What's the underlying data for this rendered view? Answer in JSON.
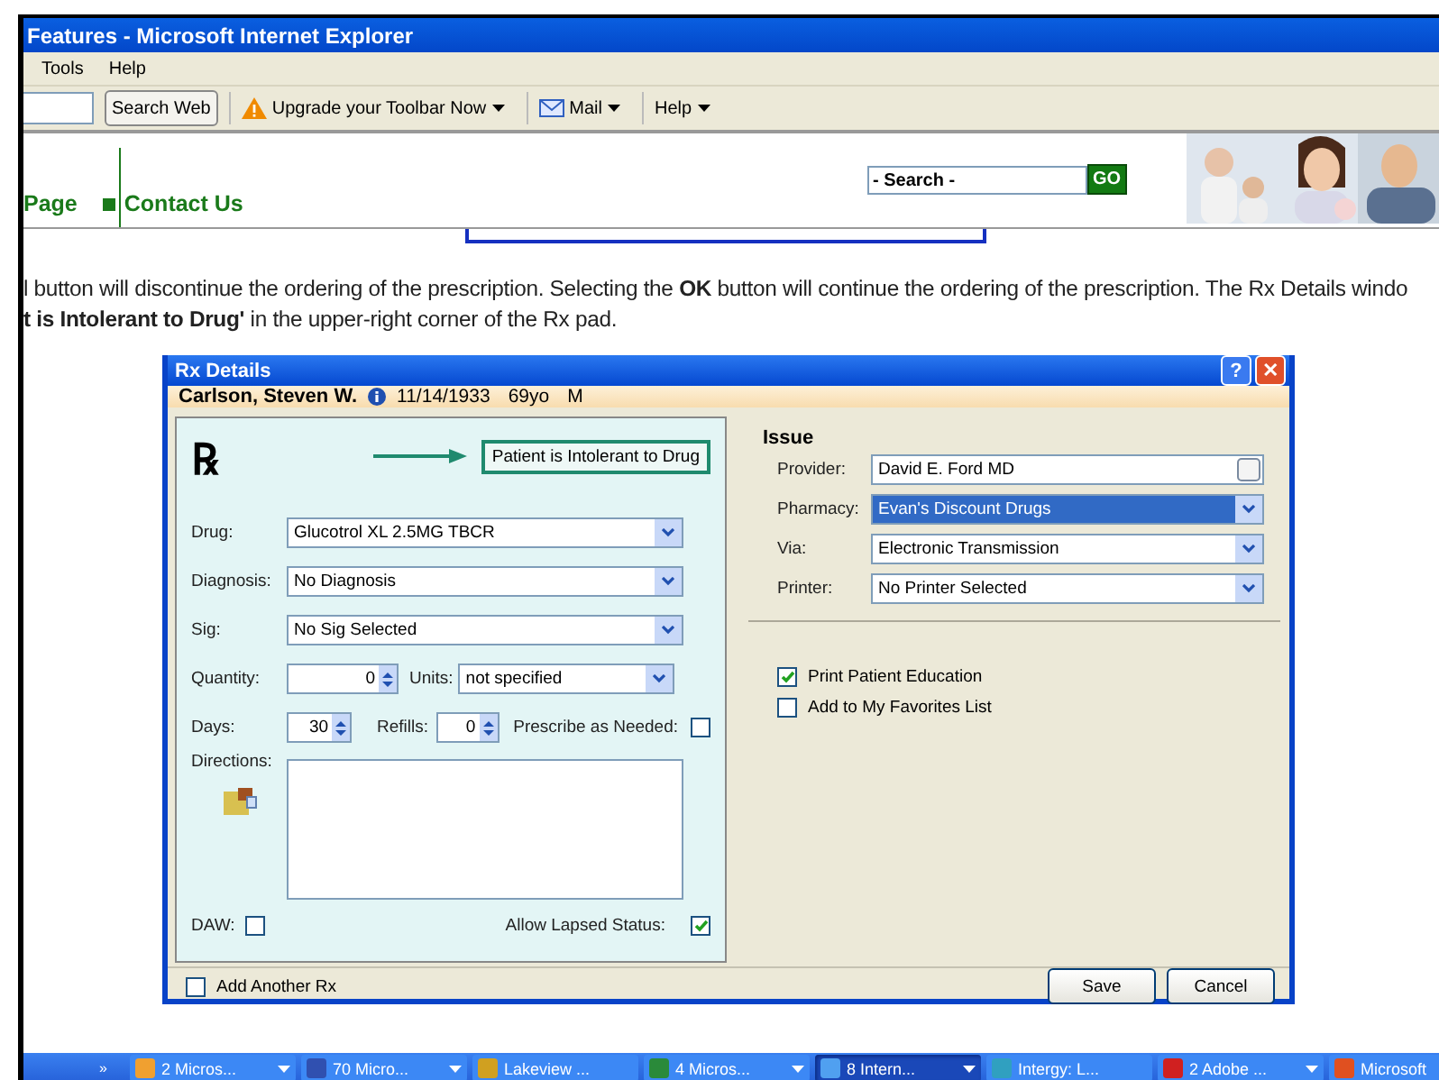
{
  "browser": {
    "title": "Features - Microsoft Internet Explorer",
    "menu": [
      "Tools",
      "Help"
    ],
    "search_button": "Search Web",
    "toolbar": [
      {
        "label": "Upgrade your Toolbar Now",
        "kind": "warning"
      },
      {
        "label": "Mail",
        "kind": "mail"
      },
      {
        "label": "Help",
        "kind": "plain"
      }
    ]
  },
  "site": {
    "nav": [
      "Page",
      "Contact Us"
    ],
    "search": {
      "placeholder": "- Search -"
    },
    "go": "GO"
  },
  "body_text": [
    "l button will discontinue the ordering of the prescription. Selecting the **OK** button will continue the ordering of the prescription. The Rx Details windo",
    "**t is Intolerant to Drug'** in the upper-right corner of the Rx pad."
  ],
  "dialog": {
    "title": "Rx Details",
    "help_button": "?",
    "close_button": "✕",
    "patient": {
      "name": "Carlson, Steven W.",
      "dob": "11/14/1933",
      "age": "69yo",
      "sex": "M"
    },
    "rx_mark": "℞",
    "alert": "Patient is Intolerant to Drug",
    "drug": {
      "label": "Drug:",
      "value": "Glucotrol XL 2.5MG TBCR"
    },
    "diagnosis": {
      "label": "Diagnosis:",
      "value": "No Diagnosis"
    },
    "sig": {
      "label": "Sig:",
      "value": "No Sig Selected"
    },
    "quantity": {
      "label": "Quantity:",
      "value": "0"
    },
    "units": {
      "label": "Units:",
      "value": "not specified"
    },
    "days": {
      "label": "Days:",
      "value": "30"
    },
    "refills": {
      "label": "Refills:",
      "value": "0"
    },
    "prescribe_as_needed": {
      "label": "Prescribe as Needed:",
      "checked": false
    },
    "directions": {
      "label": "Directions:"
    },
    "daw": {
      "label": "DAW:",
      "checked": false
    },
    "allow_lapsed": {
      "label": "Allow Lapsed Status:",
      "checked": true
    },
    "issue": {
      "heading": "Issue",
      "fields": [
        {
          "label": "Provider:",
          "value": "David E. Ford MD",
          "kind": "lookup",
          "selected": false
        },
        {
          "label": "Pharmacy:",
          "value": "Evan's Discount Drugs",
          "kind": "combo",
          "selected": true
        },
        {
          "label": "Via:",
          "value": "Electronic Transmission",
          "kind": "combo",
          "selected": false
        },
        {
          "label": "Printer:",
          "value": "No Printer Selected",
          "kind": "combo",
          "selected": false
        }
      ],
      "options": [
        {
          "label": "Print Patient Education",
          "checked": true
        },
        {
          "label": "Add to My Favorites List",
          "checked": false
        }
      ]
    },
    "add_another": {
      "label": "Add Another Rx",
      "checked": false
    },
    "buttons": [
      "Save",
      "Cancel"
    ]
  },
  "taskbar": {
    "overflow": "»",
    "items": [
      {
        "label": "2 Micros...",
        "kind": "clock",
        "grouped": true,
        "selected": false
      },
      {
        "label": "70 Micro...",
        "kind": "word",
        "grouped": true,
        "selected": false
      },
      {
        "label": "Lakeview ...",
        "kind": "folder",
        "grouped": false,
        "selected": false
      },
      {
        "label": "4 Micros...",
        "kind": "excel",
        "grouped": true,
        "selected": false
      },
      {
        "label": "8 Intern...",
        "kind": "ie",
        "grouped": true,
        "selected": true
      },
      {
        "label": "Intergy: L...",
        "kind": "app",
        "grouped": false,
        "selected": false
      },
      {
        "label": "2 Adobe ...",
        "kind": "pdf",
        "grouped": true,
        "selected": false
      },
      {
        "label": "Microsoft",
        "kind": "ppt",
        "grouped": false,
        "selected": false
      }
    ]
  }
}
